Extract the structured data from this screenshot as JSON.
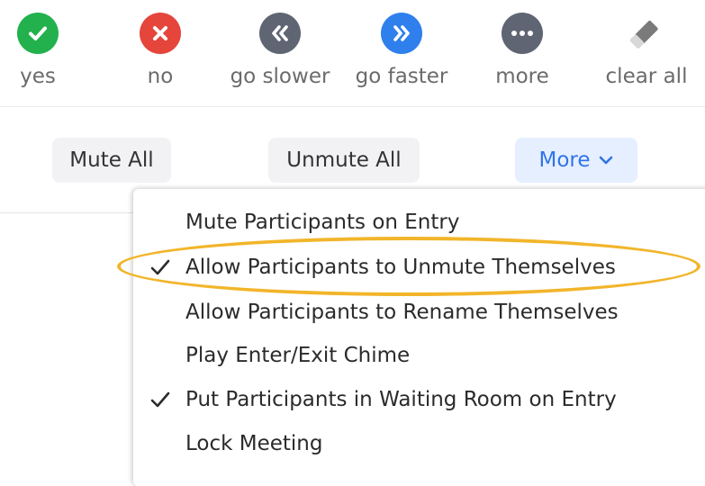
{
  "reactions": [
    {
      "label": "yes",
      "icon": "check-icon",
      "color": "#22b14c"
    },
    {
      "label": "no",
      "icon": "close-icon",
      "color": "#e5453b"
    },
    {
      "label": "go slower",
      "icon": "rewind-icon",
      "color": "#5f6573"
    },
    {
      "label": "go faster",
      "icon": "fast-forward-icon",
      "color": "#2f80ed"
    },
    {
      "label": "more",
      "icon": "ellipsis-icon",
      "color": "#5f6573"
    },
    {
      "label": "clear all",
      "icon": "eraser-icon",
      "color": "#8d8d8d"
    }
  ],
  "buttons": {
    "mute_all": "Mute All",
    "unmute_all": "Unmute All",
    "more": "More"
  },
  "menu": {
    "items": [
      {
        "label": "Mute Participants on Entry",
        "checked": false
      },
      {
        "label": "Allow Participants to Unmute Themselves",
        "checked": true,
        "highlighted": true
      },
      {
        "label": "Allow Participants to Rename Themselves",
        "checked": false
      },
      {
        "label": "Play Enter/Exit Chime",
        "checked": false
      },
      {
        "label": "Put Participants in Waiting Room on Entry",
        "checked": true
      },
      {
        "label": "Lock Meeting",
        "checked": false
      }
    ]
  },
  "colors": {
    "accent": "#2f74ea",
    "highlight": "#f2b52a"
  }
}
